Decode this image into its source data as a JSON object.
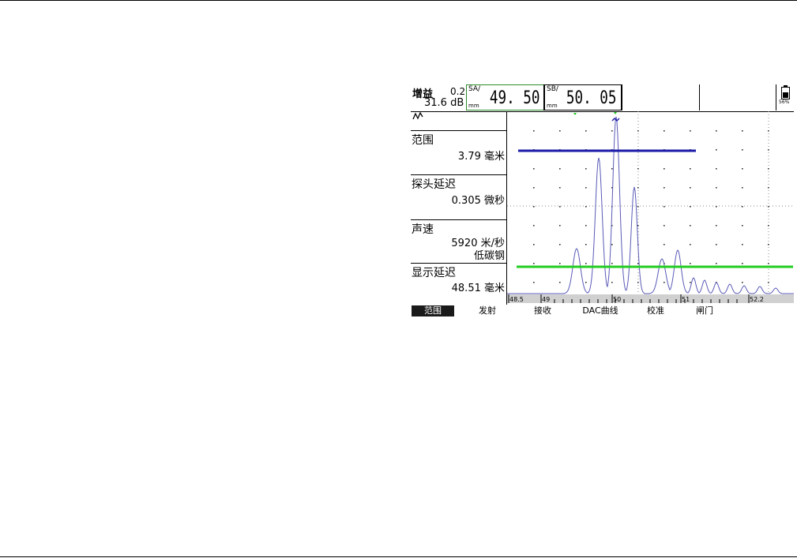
{
  "header": {
    "gain_title": "增益",
    "gain_step": "0.2",
    "gain_value": "31.6 dB",
    "readout_a": {
      "label": "SA/",
      "unit": "mm",
      "value": "49. 50"
    },
    "readout_b": {
      "label": "SB/",
      "unit": "mm",
      "value": "50. 05"
    },
    "battery_percent": "56%"
  },
  "params": {
    "rectify_icon": "rectify-wave-icon",
    "range": {
      "name": "范围",
      "value": "3.79 毫米"
    },
    "probe_delay": {
      "name": "探头延迟",
      "value": "0.305 微秒"
    },
    "velocity": {
      "name": "声速",
      "value": "5920 米/秒",
      "material": "低碳钢"
    },
    "display_delay": {
      "name": "显示延迟",
      "value": "48.51 毫米"
    }
  },
  "scale": [
    "48.5",
    "49",
    "50",
    "51",
    "52.2"
  ],
  "gate_colors": {
    "gate_a": "#1a1aa8",
    "gate_b": "#22cc22",
    "signal": "#5a5ab8"
  },
  "menu": [
    "范围",
    "发射",
    "接收",
    "DAC曲线",
    "校准",
    "闸门"
  ]
}
